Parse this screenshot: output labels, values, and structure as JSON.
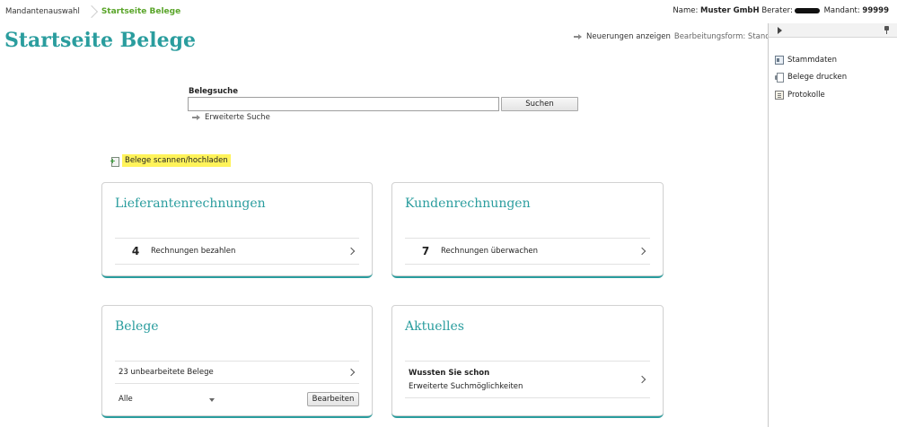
{
  "breadcrumb": {
    "root": "Mandantenauswahl",
    "current": "Startseite Belege"
  },
  "header": {
    "name_label": "Name:",
    "name_value": "Muster GmbH",
    "advisor_label": "Berater:",
    "client_label": "Mandant:",
    "client_value": "99999"
  },
  "page_title": "Startseite Belege",
  "news": {
    "link_label": "Neuerungen anzeigen",
    "mode_label": "Bearbeitungsform: Standard"
  },
  "search": {
    "label": "Belegsuche",
    "value": "",
    "button_label": "Suchen",
    "advanced_label": "Erweiterte Suche"
  },
  "upload": {
    "label": "Belege scannen/hochladen"
  },
  "cards": {
    "supplier": {
      "title": "Lieferantenrechnungen",
      "count": "4",
      "label": "Rechnungen bezahlen"
    },
    "customer": {
      "title": "Kundenrechnungen",
      "count": "7",
      "label": "Rechnungen überwachen"
    },
    "documents": {
      "title": "Belege",
      "row_label": "23 unbearbeitete Belege",
      "filter_value": "Alle",
      "edit_label": "Bearbeiten"
    },
    "news": {
      "title": "Aktuelles",
      "headline": "Wussten Sie schon",
      "text": "Erweiterte Suchmöglichkeiten"
    }
  },
  "side_panel": {
    "items": [
      {
        "label": "Stammdaten",
        "icon": "id-card-icon"
      },
      {
        "label": "Belege drucken",
        "icon": "printer-icon"
      },
      {
        "label": "Protokolle",
        "icon": "log-icon"
      }
    ]
  },
  "colors": {
    "accent_teal": "#2a9d9e",
    "breadcrumb_green": "#5aa52a",
    "highlight_yellow": "#fff35a"
  }
}
